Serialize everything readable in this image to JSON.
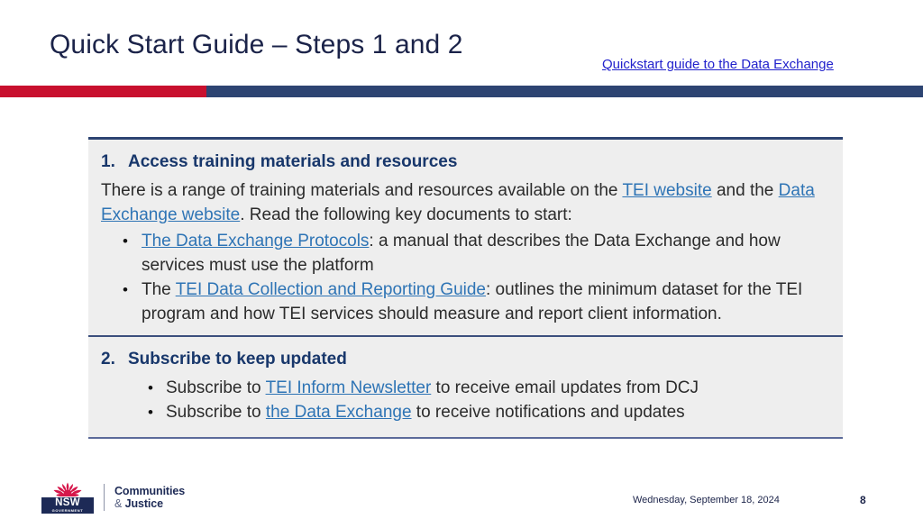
{
  "slide": {
    "title": "Quick Start Guide – Steps 1 and 2",
    "header_link": "Quickstart guide to the Data Exchange",
    "accent_red": "#c8102e",
    "accent_navy": "#2d4472",
    "panel_background": "#eeeeee",
    "link_color": "#2e74b5",
    "heading_color": "#18376b"
  },
  "sections": [
    {
      "number": "1.",
      "heading": "Access training materials and resources",
      "body": {
        "part1": "There is a range of training materials and resources available on the ",
        "link1": "TEI website",
        "part2": " and the ",
        "link2": "Data Exchange website",
        "part3": ". Read the following key documents to start:"
      },
      "bullets": [
        {
          "bullet": "•",
          "link": "The Data Exchange Protocols",
          "text": ": a manual that describes the Data Exchange and how services must use the platform",
          "prefix": ""
        },
        {
          "bullet": "•",
          "prefix": "The ",
          "link": "TEI Data Collection and Reporting Guide",
          "text": ": outlines the minimum dataset for the TEI program and how TEI services should measure and report client information."
        }
      ]
    },
    {
      "number": "2.",
      "heading": "Subscribe to keep updated",
      "bullets": [
        {
          "bullet": "•",
          "prefix": "Subscribe to ",
          "link": "TEI Inform Newsletter",
          "text": " to receive email updates from DCJ"
        },
        {
          "bullet": "•",
          "prefix": "Subscribe to ",
          "link": "the Data Exchange",
          "text": " to receive notifications and updates"
        }
      ]
    }
  ],
  "footer": {
    "logo": {
      "nsw": "NSW",
      "government": "GOVERNMENT",
      "wordmark_line1": "Communities",
      "wordmark_amp": "&",
      "wordmark_line2": "Justice"
    },
    "date": "Wednesday, September 18, 2024",
    "page_number": "8"
  }
}
